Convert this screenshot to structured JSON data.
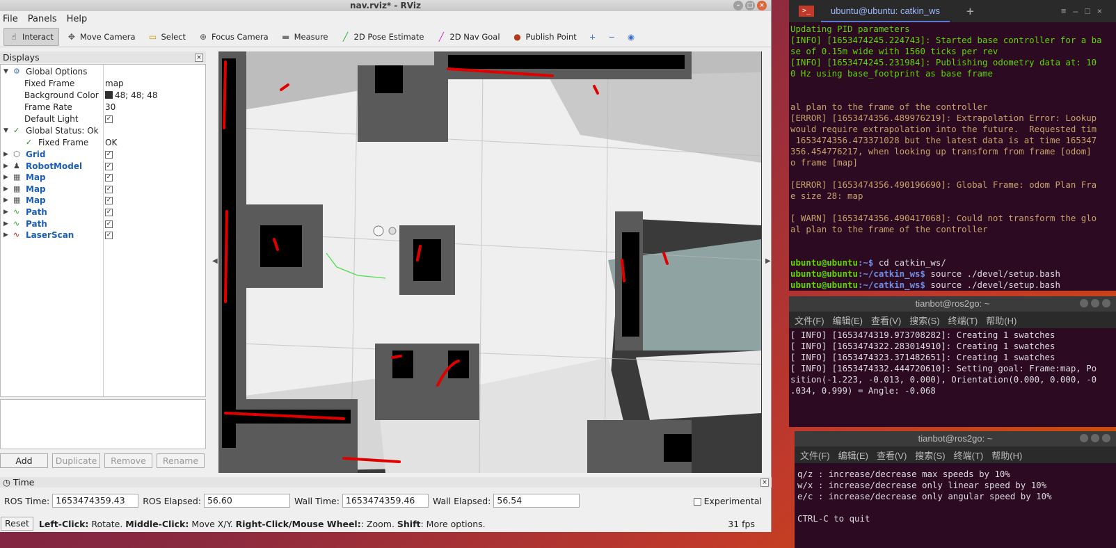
{
  "rviz": {
    "title": "nav.rviz* - RViz",
    "menu": [
      "File",
      "Panels",
      "Help"
    ],
    "tools": [
      {
        "label": "Interact",
        "icon": "hand-icon",
        "glyph": "☝",
        "color": "#333"
      },
      {
        "label": "Move Camera",
        "icon": "move-camera-icon",
        "glyph": "✥",
        "color": "#555"
      },
      {
        "label": "Select",
        "icon": "select-icon",
        "glyph": "▭",
        "color": "#c9a100"
      },
      {
        "label": "Focus Camera",
        "icon": "focus-camera-icon",
        "glyph": "⊕",
        "color": "#555"
      },
      {
        "label": "Measure",
        "icon": "measure-icon",
        "glyph": "▬",
        "color": "#777"
      },
      {
        "label": "2D Pose Estimate",
        "icon": "pose-estimate-icon",
        "glyph": "╱",
        "color": "#22aa22"
      },
      {
        "label": "2D Nav Goal",
        "icon": "nav-goal-icon",
        "glyph": "╱",
        "color": "#c020c0"
      },
      {
        "label": "Publish Point",
        "icon": "publish-point-icon",
        "glyph": "●",
        "color": "#b03a1a"
      }
    ],
    "displays_title": "Displays",
    "rows": {
      "global_options": "Global Options",
      "fixed_frame_label": "Fixed Frame",
      "fixed_frame_value": "map",
      "bg_color_label": "Background Color",
      "bg_color_value": "48; 48; 48",
      "frame_rate_label": "Frame Rate",
      "frame_rate_value": "30",
      "default_light_label": "Default Light",
      "global_status": "Global Status: Ok",
      "status_fixed_frame": "Fixed Frame",
      "status_fixed_frame_value": "OK"
    },
    "plugins": [
      "Grid",
      "RobotModel",
      "Map",
      "Map",
      "Map",
      "Path",
      "Path",
      "LaserScan"
    ],
    "buttons": [
      "Add",
      "Duplicate",
      "Remove",
      "Rename"
    ],
    "time": {
      "title": "Time",
      "ros_time_label": "ROS Time:",
      "ros_time": "1653474359.43",
      "ros_elapsed_label": "ROS Elapsed:",
      "ros_elapsed": "56.60",
      "wall_time_label": "Wall Time:",
      "wall_time": "1653474359.46",
      "wall_elapsed_label": "Wall Elapsed:",
      "wall_elapsed": "56.54",
      "experimental": "Experimental"
    },
    "status": {
      "reset": "Reset",
      "left_click": "Left-Click:",
      "left_click_desc": " Rotate. ",
      "middle_click": "Middle-Click:",
      "middle_click_desc": " Move X/Y. ",
      "right_click": "Right-Click/Mouse Wheel:",
      "right_click_desc": ": Zoom. ",
      "shift": "Shift",
      "shift_desc": ": More options.",
      "fps": "31 fps"
    }
  },
  "term1": {
    "tab": "ubuntu@ubuntu: catkin_ws",
    "lines": [
      {
        "t": "Updating PID parameters",
        "c": "green"
      },
      {
        "t": "[INFO] [1653474245.224743]: Started base controller for a ba",
        "c": "green"
      },
      {
        "t": "se of 0.15m wide with 1560 ticks per rev",
        "c": "green"
      },
      {
        "t": "[INFO] [1653474245.231984]: Publishing odometry data at: 10",
        "c": "green"
      },
      {
        "t": "0 Hz using base_footprint as base frame",
        "c": "green"
      },
      {
        "t": "",
        "c": ""
      },
      {
        "t": "",
        "c": ""
      },
      {
        "t": "al plan to the frame of the controller",
        "c": "warn"
      },
      {
        "t": "[ERROR] [1653474356.489976219]: Extrapolation Error: Lookup",
        "c": "warn"
      },
      {
        "t": "would require extrapolation into the future.  Requested tim",
        "c": "warn"
      },
      {
        "t": " 1653474356.473371028 but the latest data is at time 165347",
        "c": "warn"
      },
      {
        "t": "356.454776217, when looking up transform from frame [odom] ",
        "c": "warn"
      },
      {
        "t": "o frame [map]",
        "c": "warn"
      },
      {
        "t": "",
        "c": ""
      },
      {
        "t": "[ERROR] [1653474356.490196690]: Global Frame: odom Plan Fra",
        "c": "warn"
      },
      {
        "t": "e size 28: map",
        "c": "warn"
      },
      {
        "t": "",
        "c": ""
      },
      {
        "t": "[ WARN] [1653474356.490417068]: Could not transform the glo",
        "c": "warn"
      },
      {
        "t": "al plan to the frame of the controller",
        "c": "warn"
      },
      {
        "t": "",
        "c": ""
      },
      {
        "t": "",
        "c": ""
      }
    ],
    "prompts": [
      {
        "user": "ubuntu@ubuntu",
        "path": ":~$ ",
        "cmd": "cd catkin_ws/"
      },
      {
        "user": "ubuntu@ubuntu",
        "path": ":~/catkin_ws$ ",
        "cmd": "source ./devel/setup.bash"
      },
      {
        "user": "ubuntu@ubuntu",
        "path": ":~/catkin_ws$ ",
        "cmd": "source ./devel/setup.bash"
      }
    ]
  },
  "term2": {
    "title": "tianbot@ros2go: ~",
    "menu": [
      "文件(F)",
      "编辑(E)",
      "查看(V)",
      "搜索(S)",
      "终端(T)",
      "帮助(H)"
    ],
    "lines": [
      "[ INFO] [1653474319.973708282]: Creating 1 swatches",
      "[ INFO] [1653474322.283014910]: Creating 1 swatches",
      "[ INFO] [1653474323.371482651]: Creating 1 swatches",
      "[ INFO] [1653474332.444720610]: Setting goal: Frame:map, Po",
      "sition(-1.223, -0.013, 0.000), Orientation(0.000, 0.000, -0",
      ".034, 0.999) = Angle: -0.068"
    ]
  },
  "term3": {
    "title": "tianbot@ros2go: ~",
    "menu": [
      "文件(F)",
      "编辑(E)",
      "查看(V)",
      "搜索(S)",
      "终端(T)",
      "帮助(H)"
    ],
    "lines": [
      "q/z : increase/decrease max speeds by 10%",
      "w/x : increase/decrease only linear speed by 10%",
      "e/c : increase/decrease only angular speed by 10%",
      "",
      "CTRL-C to quit"
    ]
  }
}
